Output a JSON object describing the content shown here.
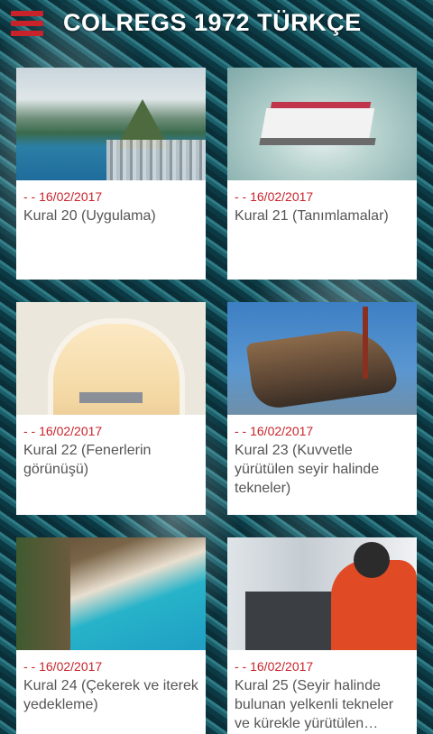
{
  "header": {
    "title": "COLREGS 1972 TÜRKÇE",
    "menu_icon": "hamburger-menu-icon",
    "accent": "#c8232b"
  },
  "cards": [
    {
      "date": "- - 16/02/2017",
      "title": "Kural 20 (Uygulama)"
    },
    {
      "date": "- - 16/02/2017",
      "title": "Kural 21 (Tanımlamalar)"
    },
    {
      "date": "- - 16/02/2017",
      "title": "Kural 22 (Fenerlerin görünüşü)"
    },
    {
      "date": "- - 16/02/2017",
      "title": "Kural 23 (Kuvvetle yürütülen seyir halinde tekneler)"
    },
    {
      "date": "- - 16/02/2017",
      "title": "Kural 24 (Çekerek ve iterek yedekleme)"
    },
    {
      "date": "- - 16/02/2017",
      "title": "Kural 25 (Seyir halinde bulunan yelkenli tekneler ve kürekle yürütülen…"
    }
  ]
}
